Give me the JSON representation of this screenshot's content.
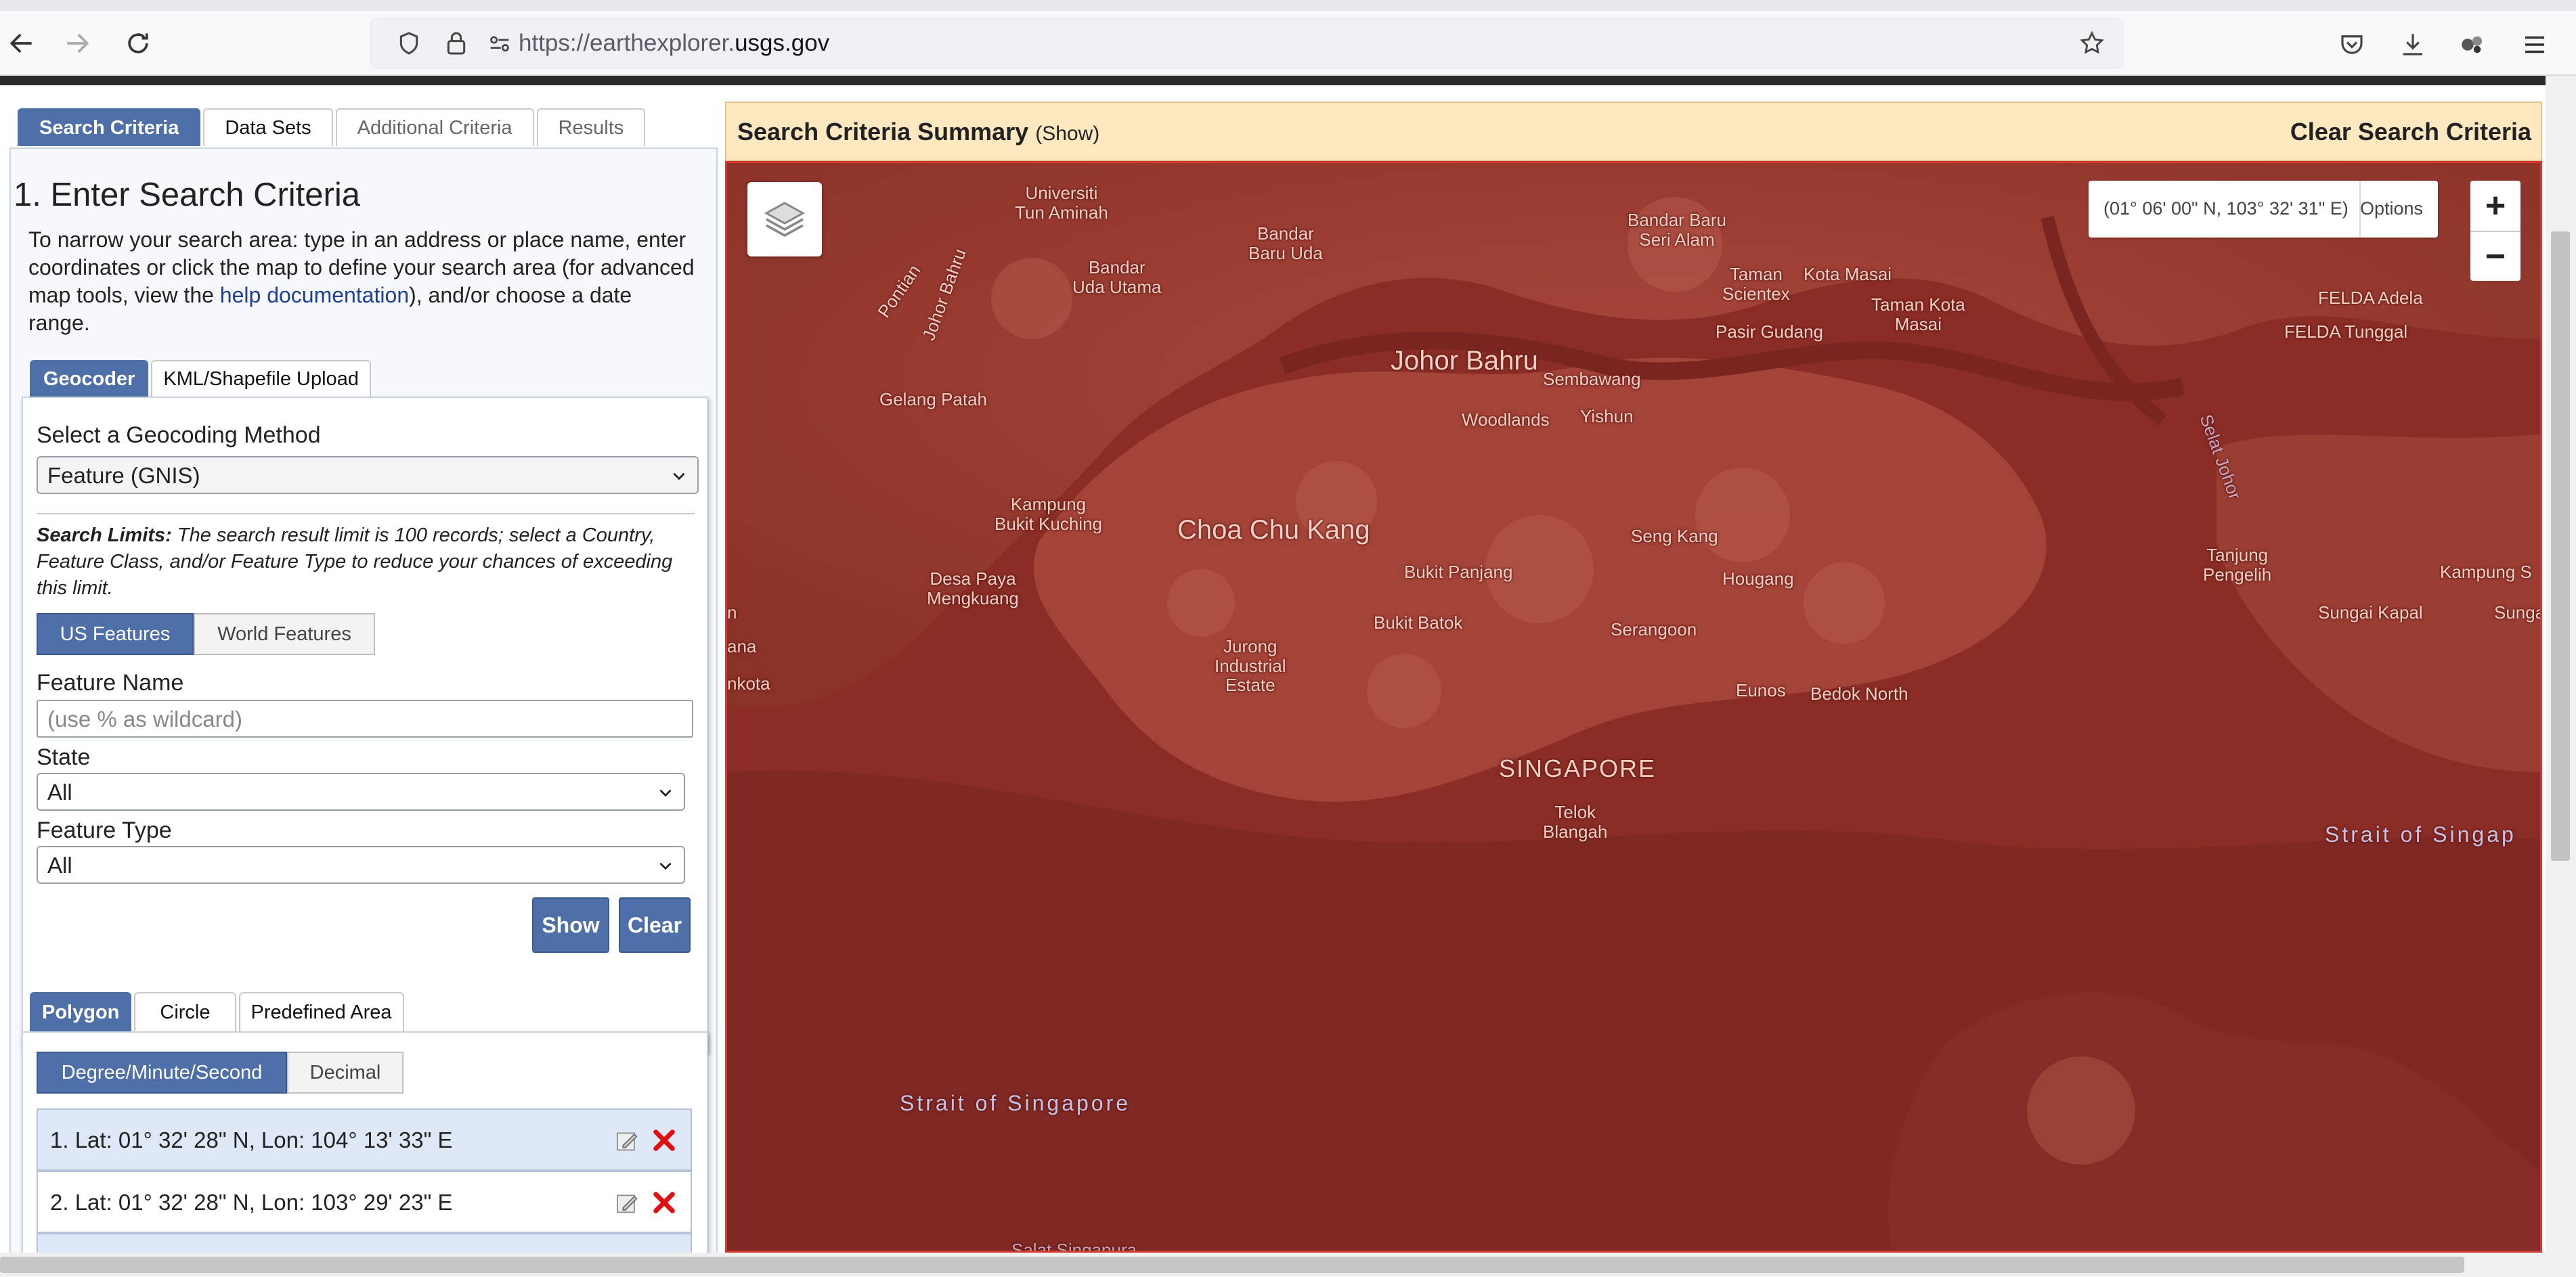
{
  "browser": {
    "url_prefix": "https://earthexplorer.",
    "url_domain": "usgs.gov",
    "icons": [
      "back-arrow-icon",
      "forward-arrow-icon",
      "reload-icon",
      "shield-icon",
      "lock-icon",
      "permissions-icon",
      "bookmark-star-icon",
      "pocket-icon",
      "download-icon",
      "extensions-icon",
      "menu-icon"
    ]
  },
  "left": {
    "tabs": [
      {
        "label": "Search Criteria",
        "active": true
      },
      {
        "label": "Data Sets"
      },
      {
        "label": "Additional Criteria"
      },
      {
        "label": "Results"
      }
    ],
    "title": "1. Enter Search Criteria",
    "intro_before": "To narrow your search area: type in an address or place name, enter coordinates or click the map to define your search area (for advanced map tools, view the ",
    "intro_link": "help documentation",
    "intro_after": "), and/or choose a date range.",
    "geo_tabs": [
      "Geocoder",
      "KML/Shapefile Upload"
    ],
    "method_label": "Select a Geocoding Method",
    "method_value": "Feature (GNIS)",
    "limits_bold": "Search Limits:",
    "limits_text": " The search result limit is 100 records; select a Country, Feature Class, and/or Feature Type to reduce your chances of exceeding this limit.",
    "feature_buttons": [
      "US Features",
      "World Features"
    ],
    "feature_name_label": "Feature Name",
    "feature_name_placeholder": "(use % as wildcard)",
    "state_label": "State",
    "state_value": "All",
    "type_label": "Feature Type",
    "type_value": "All",
    "show_label": "Show",
    "clear_label": "Clear",
    "area_tabs": [
      "Polygon",
      "Circle",
      "Predefined Area"
    ],
    "format_buttons": [
      "Degree/Minute/Second",
      "Decimal"
    ],
    "coords": [
      "1.  Lat: 01° 32' 28\" N, Lon: 104° 13' 33\" E",
      "2.  Lat: 01° 32' 28\" N, Lon: 103° 29' 23\" E"
    ]
  },
  "summary": {
    "title": "Search Criteria Summary",
    "show": "(Show)",
    "clear": "Clear Search Criteria"
  },
  "map": {
    "coord_readout": "(01° 06' 00\" N, 103° 32' 31\" E)",
    "options_label": "Options",
    "zoom_in": "+",
    "zoom_out": "−",
    "labels": {
      "universiti": "Universiti\nTun Aminah",
      "bandar_baru_uda": "Bandar\nBaru Uda",
      "bandar_uda_utama": "Bandar\nUda Utama",
      "bandar_baru_seri_alam": "Bandar Baru\nSeri Alam",
      "taman_scientex": "Taman\nScientex",
      "kota_masai": "Kota Masai",
      "taman_kota_masai": "Taman Kota\nMasai",
      "pasir_gudang": "Pasir Gudang",
      "felda_adela": "FELDA Adela",
      "felda_tunggal": "FELDA Tunggal",
      "johor_bahru": "Johor Bahru",
      "sembawang": "Sembawang",
      "woodlands": "Woodlands",
      "yishun": "Yishun",
      "pontian": "Pontian",
      "johor_bahru_road": "Johor Bahru",
      "gelang_patah": "Gelang Patah",
      "kampung_bukit_kuching": "Kampung\nBukit Kuching",
      "choa_chu_kang": "Choa Chu Kang",
      "seng_kang": "Seng Kang",
      "bukit_panjang": "Bukit Panjang",
      "hougang": "Hougang",
      "desa_paya_mengkuang": "Desa Paya\nMengkuang",
      "bukit_batok": "Bukit Batok",
      "serangoon": "Serangoon",
      "jurong_industrial_estate": "Jurong\nIndustrial\nEstate",
      "tanjung_pengelih": "Tanjung\nPengelih",
      "kampung_s": "Kampung S",
      "sungai_kapal": "Sungai Kapal",
      "sunga": "Sunga",
      "eunos": "Eunos",
      "bedok_north": "Bedok North",
      "singapore": "SINGAPORE",
      "telok_blangah": "Telok\nBlangah",
      "strait_of_singapore_east": "Strait of Singap",
      "strait_of_singapore_west": "Strait of Singapore",
      "selat_johor": "Selat Johor",
      "salat_singapura": "Salat Singapura",
      "ana": "ana",
      "nkota": "nkota",
      "n_edge": "n"
    }
  }
}
